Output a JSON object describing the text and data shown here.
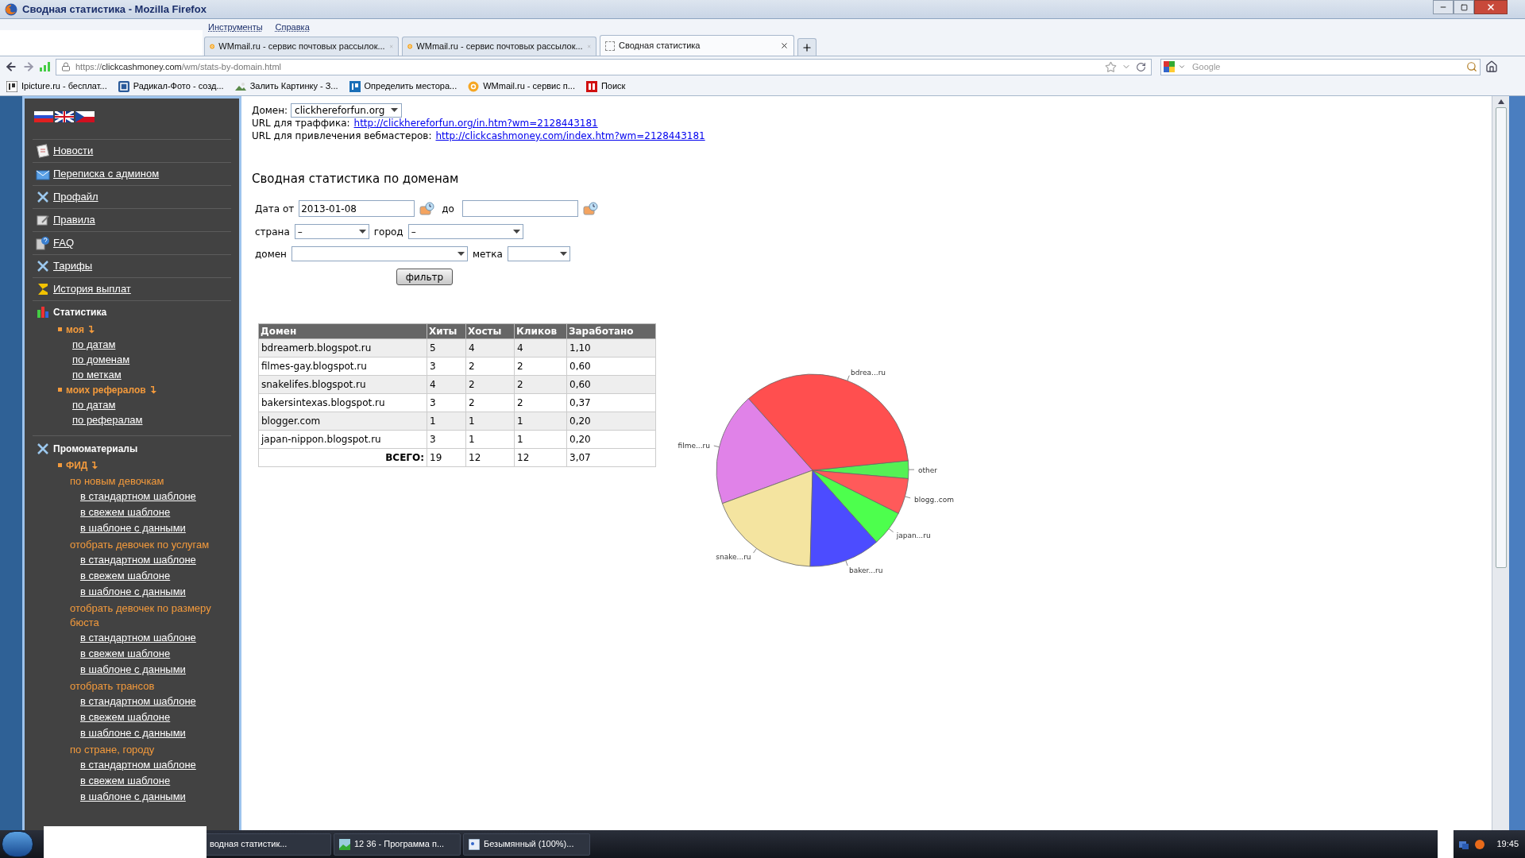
{
  "window": {
    "title": "Сводная статистика - Mozilla Firefox"
  },
  "menu": [
    "Инструменты",
    "Справка"
  ],
  "tabs": [
    {
      "label": "WMmail.ru - сервис почтовых рассылок...",
      "selected": false
    },
    {
      "label": "WMmail.ru - сервис почтовых рассылок...",
      "selected": false
    },
    {
      "label": "Сводная статистика",
      "selected": true
    }
  ],
  "address": {
    "scheme": "https://",
    "host": "clickcashmoney.com",
    "path": "/wm/stats-by-domain.html"
  },
  "search": {
    "placeholder": "Google"
  },
  "bookmarks": [
    "Ipicture.ru - бесплат...",
    "Радикал-Фото - созд...",
    "Залить Картинку - З...",
    "Определить местора...",
    "WMmail.ru - сервис п...",
    "Поиск"
  ],
  "sidebar": {
    "menu": [
      "Новости",
      "Переписка с админом",
      "Профайл",
      "Правила",
      "FAQ",
      "Тарифы",
      "История выплат"
    ],
    "statistics": {
      "title": "Статистика",
      "groups": [
        {
          "label": "моя",
          "links": [
            "по датам",
            "по доменам",
            "по меткам"
          ]
        },
        {
          "label": "моих рефералов",
          "links": [
            "по датам",
            "по рефералам"
          ]
        }
      ]
    },
    "promo": {
      "title": "Промоматериалы",
      "feed": "ФИД",
      "groups": [
        {
          "label": "по новым девочкам",
          "links": [
            "в стандартном шаблоне",
            "в свежем шаблоне",
            "в шаблоне с данными"
          ]
        },
        {
          "label": "отобрать девочек по услугам",
          "links": [
            "в стандартном шаблоне",
            "в свежем шаблоне",
            "в шаблоне с данными"
          ]
        },
        {
          "label": "отобрать девочек по размеру бюста",
          "links": [
            "в стандартном шаблоне",
            "в свежем шаблоне",
            "в шаблоне с данными"
          ]
        },
        {
          "label": "отобрать трансов",
          "links": [
            "в стандартном шаблоне",
            "в свежем шаблоне",
            "в шаблоне с данными"
          ]
        },
        {
          "label": "по стране, городу",
          "links": [
            "в стандартном шаблоне",
            "в свежем шаблоне",
            "в шаблоне с данными"
          ]
        }
      ]
    }
  },
  "main": {
    "domain_label": "Домен:",
    "domain_value": "clickhereforfun.org",
    "traffic_label": "URL для траффика:",
    "traffic_url": "http://clickhereforfun.org/in.htm?wm=2128443181",
    "webmaster_label": "URL для привлечения вебмастеров:",
    "webmaster_url": "http://clickcashmoney.com/index.htm?wm=2128443181",
    "heading": "Сводная статистика по доменам",
    "filter": {
      "date_from_label": "Дата от",
      "date_from": "2013-01-08",
      "date_to_label": "до",
      "country_label": "страна",
      "country": "–",
      "city_label": "город",
      "city": "–",
      "domain_label": "домен",
      "tag_label": "метка",
      "button": "фильтр"
    },
    "table": {
      "columns": [
        "Домен",
        "Хиты",
        "Хосты",
        "Кликов",
        "Заработано"
      ],
      "rows": [
        [
          "bdreamerb.blogspot.ru",
          "5",
          "4",
          "4",
          "1,10"
        ],
        [
          "filmes-gay.blogspot.ru",
          "3",
          "2",
          "2",
          "0,60"
        ],
        [
          "snakelifes.blogspot.ru",
          "4",
          "2",
          "2",
          "0,60"
        ],
        [
          "bakersintexas.blogspot.ru",
          "3",
          "2",
          "2",
          "0,37"
        ],
        [
          "blogger.com",
          "1",
          "1",
          "1",
          "0,20"
        ],
        [
          "japan-nippon.blogspot.ru",
          "3",
          "1",
          "1",
          "0,20"
        ]
      ],
      "total": {
        "label": "ВСЕГО:",
        "values": [
          "19",
          "12",
          "12",
          "3,07"
        ]
      }
    },
    "chart_data": {
      "type": "pie",
      "categories": [
        "other",
        "bdrea...ru",
        "filme...ru",
        "snake...ru",
        "baker...ru",
        "japan...ru",
        "blogg..com"
      ],
      "values": [
        3,
        35,
        19,
        19,
        12,
        6,
        6
      ]
    }
  },
  "taskbar": {
    "items": [
      "водная статистик...",
      "12 36 - Программа п...",
      "Безымянный (100%)..."
    ],
    "clock": "19:45"
  }
}
